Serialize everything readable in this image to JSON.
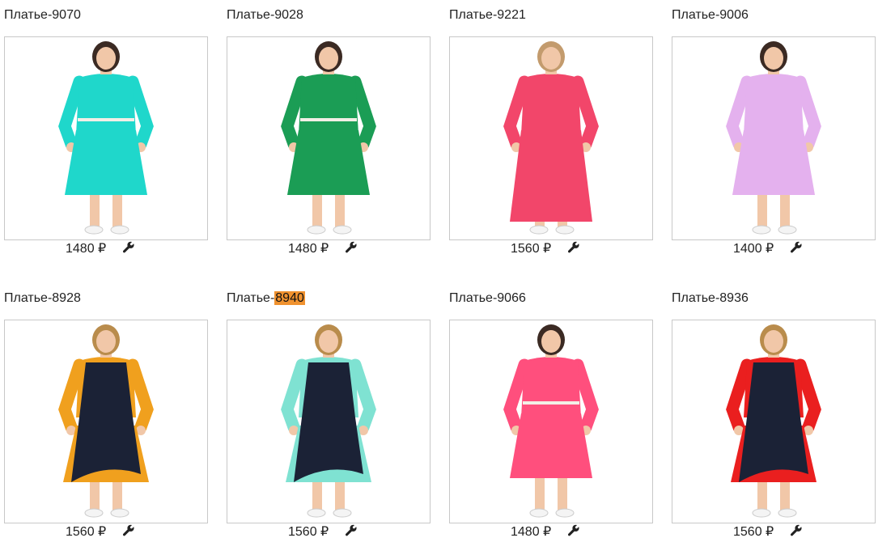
{
  "products": [
    {
      "title": "Платье-9070",
      "price": "1480 ₽",
      "colors": {
        "dress": "#1fd7cb",
        "belt": "#f2efe6",
        "top": "#1fd7cb",
        "accent": "#1fd7cb",
        "hair": "#3b2a23"
      }
    },
    {
      "title": "Платье-9028",
      "price": "1480 ₽",
      "colors": {
        "dress": "#1b9d55",
        "belt": "#f2efe6",
        "top": "#1b9d55",
        "accent": "#1b9d55",
        "hair": "#3b2a23"
      }
    },
    {
      "title": "Платье-9221",
      "price": "1560 ₽",
      "colors": {
        "dress": "#f2466a",
        "belt": "#f2466a",
        "top": "#f2466a",
        "accent": "#f2466a",
        "hair": "#c39b6d"
      }
    },
    {
      "title": "Платье-9006",
      "price": "1400 ₽",
      "colors": {
        "dress": "#e4b1ee",
        "belt": "#e4b1ee",
        "top": "#e4b1ee",
        "accent": "#e4b1ee",
        "hair": "#3b2a23"
      }
    },
    {
      "title": "Платье-8928",
      "price": "1560 ₽",
      "colors": {
        "dress": "#1b2236",
        "belt": "#1b2236",
        "top": "#f0a01e",
        "accent": "#f0a01e",
        "hair": "#b98c4c"
      }
    },
    {
      "title_prefix": "Платье-",
      "title_highlight": "8940",
      "price": "1560 ₽",
      "colors": {
        "dress": "#1b2236",
        "belt": "#1b2236",
        "top": "#7fe2d2",
        "accent": "#7fe2d2",
        "hair": "#b98c4c"
      }
    },
    {
      "title": "Платье-9066",
      "price": "1480 ₽",
      "colors": {
        "dress": "#ff4f7d",
        "belt": "#f2efe6",
        "top": "#ff4f7d",
        "accent": "#ff4f7d",
        "hair": "#3b2a23"
      }
    },
    {
      "title": "Платье-8936",
      "price": "1560 ₽",
      "colors": {
        "dress": "#1b2236",
        "belt": "#1b2236",
        "top": "#ea1f1f",
        "accent": "#ea1f1f",
        "hair": "#b98c4c"
      }
    }
  ],
  "icons": {
    "price_action": "wrench-icon"
  },
  "colors": {
    "search_highlight": "#f0922f",
    "card_border": "#c8c8c8"
  }
}
